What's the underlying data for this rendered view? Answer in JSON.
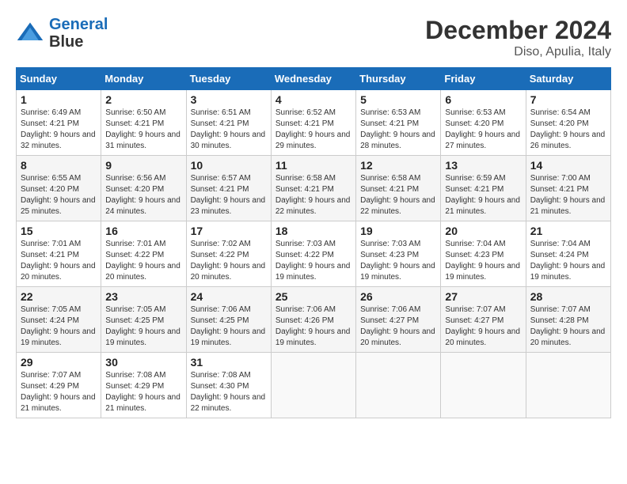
{
  "logo": {
    "line1": "General",
    "line2": "Blue"
  },
  "title": "December 2024",
  "location": "Diso, Apulia, Italy",
  "days_of_week": [
    "Sunday",
    "Monday",
    "Tuesday",
    "Wednesday",
    "Thursday",
    "Friday",
    "Saturday"
  ],
  "weeks": [
    [
      {
        "day": 1,
        "sunrise": "6:49 AM",
        "sunset": "4:21 PM",
        "daylight": "9 hours and 32 minutes."
      },
      {
        "day": 2,
        "sunrise": "6:50 AM",
        "sunset": "4:21 PM",
        "daylight": "9 hours and 31 minutes."
      },
      {
        "day": 3,
        "sunrise": "6:51 AM",
        "sunset": "4:21 PM",
        "daylight": "9 hours and 30 minutes."
      },
      {
        "day": 4,
        "sunrise": "6:52 AM",
        "sunset": "4:21 PM",
        "daylight": "9 hours and 29 minutes."
      },
      {
        "day": 5,
        "sunrise": "6:53 AM",
        "sunset": "4:21 PM",
        "daylight": "9 hours and 28 minutes."
      },
      {
        "day": 6,
        "sunrise": "6:53 AM",
        "sunset": "4:20 PM",
        "daylight": "9 hours and 27 minutes."
      },
      {
        "day": 7,
        "sunrise": "6:54 AM",
        "sunset": "4:20 PM",
        "daylight": "9 hours and 26 minutes."
      }
    ],
    [
      {
        "day": 8,
        "sunrise": "6:55 AM",
        "sunset": "4:20 PM",
        "daylight": "9 hours and 25 minutes."
      },
      {
        "day": 9,
        "sunrise": "6:56 AM",
        "sunset": "4:20 PM",
        "daylight": "9 hours and 24 minutes."
      },
      {
        "day": 10,
        "sunrise": "6:57 AM",
        "sunset": "4:21 PM",
        "daylight": "9 hours and 23 minutes."
      },
      {
        "day": 11,
        "sunrise": "6:58 AM",
        "sunset": "4:21 PM",
        "daylight": "9 hours and 22 minutes."
      },
      {
        "day": 12,
        "sunrise": "6:58 AM",
        "sunset": "4:21 PM",
        "daylight": "9 hours and 22 minutes."
      },
      {
        "day": 13,
        "sunrise": "6:59 AM",
        "sunset": "4:21 PM",
        "daylight": "9 hours and 21 minutes."
      },
      {
        "day": 14,
        "sunrise": "7:00 AM",
        "sunset": "4:21 PM",
        "daylight": "9 hours and 21 minutes."
      }
    ],
    [
      {
        "day": 15,
        "sunrise": "7:01 AM",
        "sunset": "4:21 PM",
        "daylight": "9 hours and 20 minutes."
      },
      {
        "day": 16,
        "sunrise": "7:01 AM",
        "sunset": "4:22 PM",
        "daylight": "9 hours and 20 minutes."
      },
      {
        "day": 17,
        "sunrise": "7:02 AM",
        "sunset": "4:22 PM",
        "daylight": "9 hours and 20 minutes."
      },
      {
        "day": 18,
        "sunrise": "7:03 AM",
        "sunset": "4:22 PM",
        "daylight": "9 hours and 19 minutes."
      },
      {
        "day": 19,
        "sunrise": "7:03 AM",
        "sunset": "4:23 PM",
        "daylight": "9 hours and 19 minutes."
      },
      {
        "day": 20,
        "sunrise": "7:04 AM",
        "sunset": "4:23 PM",
        "daylight": "9 hours and 19 minutes."
      },
      {
        "day": 21,
        "sunrise": "7:04 AM",
        "sunset": "4:24 PM",
        "daylight": "9 hours and 19 minutes."
      }
    ],
    [
      {
        "day": 22,
        "sunrise": "7:05 AM",
        "sunset": "4:24 PM",
        "daylight": "9 hours and 19 minutes."
      },
      {
        "day": 23,
        "sunrise": "7:05 AM",
        "sunset": "4:25 PM",
        "daylight": "9 hours and 19 minutes."
      },
      {
        "day": 24,
        "sunrise": "7:06 AM",
        "sunset": "4:25 PM",
        "daylight": "9 hours and 19 minutes."
      },
      {
        "day": 25,
        "sunrise": "7:06 AM",
        "sunset": "4:26 PM",
        "daylight": "9 hours and 19 minutes."
      },
      {
        "day": 26,
        "sunrise": "7:06 AM",
        "sunset": "4:27 PM",
        "daylight": "9 hours and 20 minutes."
      },
      {
        "day": 27,
        "sunrise": "7:07 AM",
        "sunset": "4:27 PM",
        "daylight": "9 hours and 20 minutes."
      },
      {
        "day": 28,
        "sunrise": "7:07 AM",
        "sunset": "4:28 PM",
        "daylight": "9 hours and 20 minutes."
      }
    ],
    [
      {
        "day": 29,
        "sunrise": "7:07 AM",
        "sunset": "4:29 PM",
        "daylight": "9 hours and 21 minutes."
      },
      {
        "day": 30,
        "sunrise": "7:08 AM",
        "sunset": "4:29 PM",
        "daylight": "9 hours and 21 minutes."
      },
      {
        "day": 31,
        "sunrise": "7:08 AM",
        "sunset": "4:30 PM",
        "daylight": "9 hours and 22 minutes."
      },
      null,
      null,
      null,
      null
    ]
  ]
}
